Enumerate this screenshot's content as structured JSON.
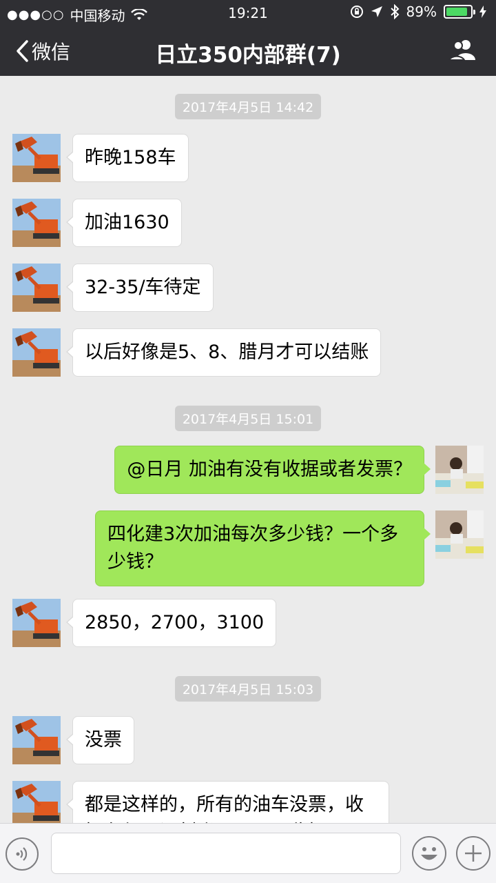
{
  "status_bar": {
    "signal_dots": "●●●○○",
    "carrier": "中国移动",
    "time": "19:21",
    "battery_percent": "89%",
    "battery_level": 0.89,
    "battery_color": "#4cd964"
  },
  "nav": {
    "back_label": "微信",
    "title": "日立350内部群(7)",
    "group_icon": "group-members-icon"
  },
  "messages": [
    {
      "type": "time",
      "text": "2017年4月5日 14:42"
    },
    {
      "type": "in",
      "text": "昨晚158车"
    },
    {
      "type": "in",
      "text": "加油1630"
    },
    {
      "type": "in",
      "text": "32-35/车待定"
    },
    {
      "type": "in",
      "text": "以后好像是5、8、腊月才可以结账"
    },
    {
      "type": "time",
      "text": "2017年4月5日 15:01"
    },
    {
      "type": "out",
      "text": "@日月 加油有没有收据或者发票？"
    },
    {
      "type": "out",
      "text": "四化建3次加油每次多少钱？一个多少钱？"
    },
    {
      "type": "in",
      "text": "2850，2700，3100"
    },
    {
      "type": "time",
      "text": "2017年4月5日 15:03"
    },
    {
      "type": "in",
      "text": "没票"
    },
    {
      "type": "in",
      "text": "都是这样的，所有的油车没票，收据有但要记刻账，可以要收据是"
    }
  ],
  "colors": {
    "header_bg": "#2f2f33",
    "chat_bg": "#ebebeb",
    "out_bubble": "#a0e75a",
    "in_bubble": "#ffffff"
  }
}
